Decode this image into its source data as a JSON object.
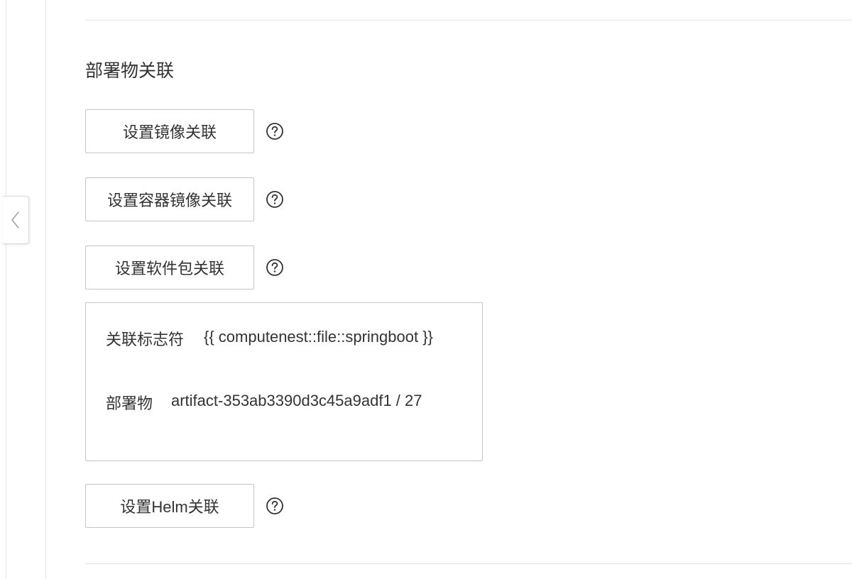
{
  "section": {
    "title": "部署物关联"
  },
  "buttons": {
    "image": "设置镜像关联",
    "container_image": "设置容器镜像关联",
    "software_package": "设置软件包关联",
    "helm": "设置Helm关联"
  },
  "association_card": {
    "identifier_label": "关联标志符",
    "identifier_value": "{{ computenest::file::springboot }}",
    "artifact_label": "部署物",
    "artifact_value": "artifact-353ab3390d3c45a9adf1 / 27"
  },
  "icons": {
    "help": "question-circle-icon",
    "collapse": "chevron-left-icon"
  },
  "colors": {
    "text": "#333333",
    "border": "#c4c6cf",
    "divider": "#e6e6e6"
  }
}
